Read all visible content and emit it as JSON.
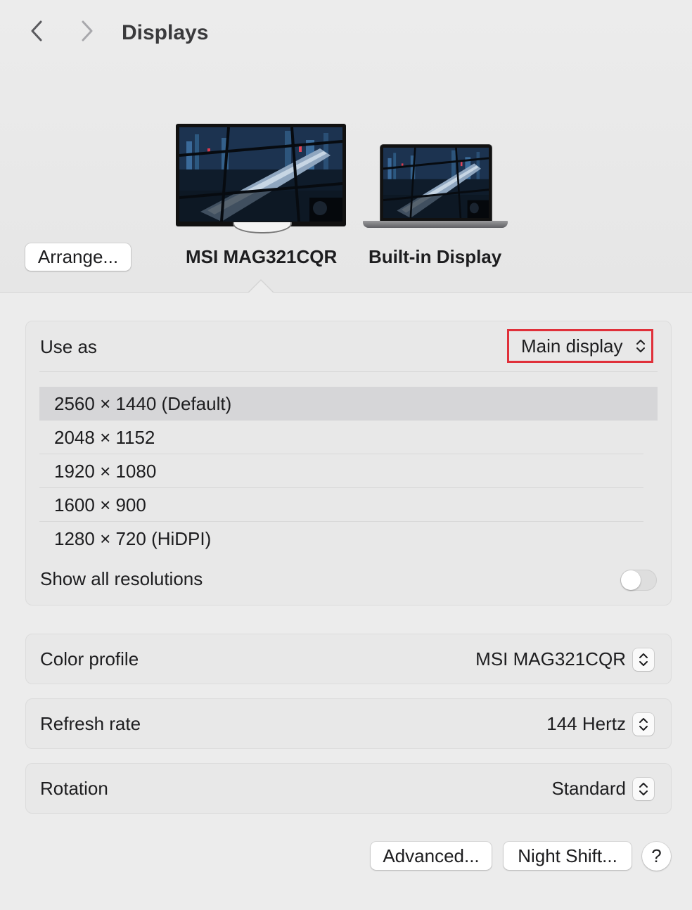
{
  "header": {
    "title": "Displays",
    "back_icon": "chevron-left-icon",
    "forward_icon": "chevron-right-icon"
  },
  "arrangement": {
    "arrange_button": "Arrange...",
    "displays": [
      {
        "name": "MSI MAG321CQR",
        "selected": true
      },
      {
        "name": "Built-in Display",
        "selected": false
      }
    ]
  },
  "settings": {
    "use_as": {
      "label": "Use as",
      "value": "Main display"
    },
    "resolutions": [
      {
        "label": "2560 × 1440 (Default)",
        "selected": true
      },
      {
        "label": "2048 × 1152",
        "selected": false
      },
      {
        "label": "1920 × 1080",
        "selected": false
      },
      {
        "label": "1600 × 900",
        "selected": false
      },
      {
        "label": "1280 × 720 (HiDPI)",
        "selected": false
      }
    ],
    "show_all": {
      "label": "Show all resolutions",
      "enabled": false
    },
    "color_profile": {
      "label": "Color profile",
      "value": "MSI MAG321CQR"
    },
    "refresh_rate": {
      "label": "Refresh rate",
      "value": "144 Hertz"
    },
    "rotation": {
      "label": "Rotation",
      "value": "Standard"
    }
  },
  "footer": {
    "advanced": "Advanced...",
    "night_shift": "Night Shift...",
    "help": "?"
  },
  "colors": {
    "highlight_border": "#e0303a",
    "selected_row": "#d6d6d8",
    "background": "#ececec"
  }
}
